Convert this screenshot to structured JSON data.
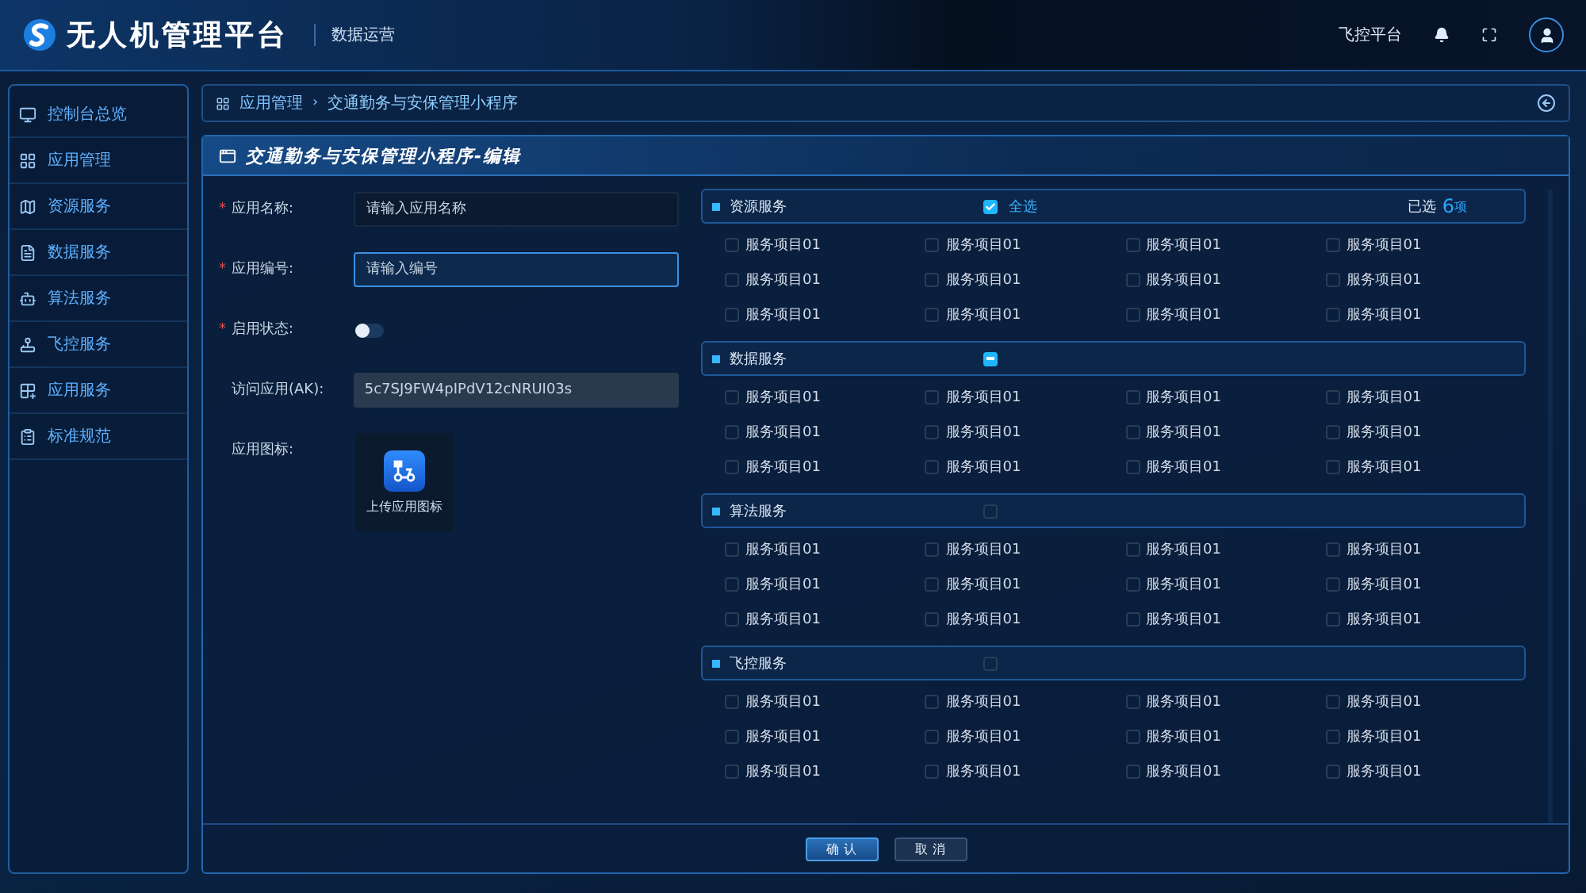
{
  "header": {
    "title": "无人机管理平台",
    "subtitle": "数据运营",
    "platform_link": "飞控平台"
  },
  "sidebar": {
    "items": [
      {
        "label": "控制台总览",
        "selected": false
      },
      {
        "label": "应用管理",
        "selected": false
      },
      {
        "label": "资源服务",
        "selected": false
      },
      {
        "label": "数据服务",
        "selected": false
      },
      {
        "label": "算法服务",
        "selected": false
      },
      {
        "label": "飞控服务",
        "selected": false
      },
      {
        "label": "应用服务",
        "selected": false
      },
      {
        "label": "标准规范",
        "selected": false
      }
    ]
  },
  "breadcrumb": {
    "separator": "›",
    "items": [
      "应用管理",
      "交通勤务与安保管理小程序"
    ]
  },
  "panel": {
    "title": "交通勤务与安保管理小程序-编辑",
    "form": [
      {
        "kind": "input",
        "label": "应用名称:",
        "required_mark": "*",
        "placeholder": "请输入应用名称",
        "focused": false
      },
      {
        "kind": "input",
        "label": "应用编号:",
        "required_mark": "*",
        "placeholder": "请输入编号",
        "focused": true
      },
      {
        "kind": "switch",
        "label": "启用状态:",
        "required_mark": "*",
        "on": false
      },
      {
        "kind": "readonly",
        "label": "访问应用(AK):",
        "value": "5c7SJ9FW4pIPdV12cNRUI03s"
      },
      {
        "kind": "upload",
        "label": "应用图标:",
        "caption": "上传应用图标"
      }
    ],
    "groups": [
      {
        "name": "资源服务",
        "checked": true,
        "indeterminate": false,
        "select_all": "全选",
        "selected_label": "已选",
        "selected_count": "6",
        "selected_unit": "项",
        "items": [
          {
            "label": "服务项目01",
            "checked": false
          },
          {
            "label": "服务项目01",
            "checked": false
          },
          {
            "label": "服务项目01",
            "checked": false
          },
          {
            "label": "服务项目01",
            "checked": false
          },
          {
            "label": "服务项目01",
            "checked": false
          },
          {
            "label": "服务项目01",
            "checked": false
          },
          {
            "label": "服务项目01",
            "checked": false
          },
          {
            "label": "服务项目01",
            "checked": false
          },
          {
            "label": "服务项目01",
            "checked": false
          },
          {
            "label": "服务项目01",
            "checked": false
          },
          {
            "label": "服务项目01",
            "checked": false
          },
          {
            "label": "服务项目01",
            "checked": false
          }
        ]
      },
      {
        "name": "数据服务",
        "checked": false,
        "indeterminate": true,
        "items": [
          {
            "label": "服务项目01",
            "checked": false
          },
          {
            "label": "服务项目01",
            "checked": false
          },
          {
            "label": "服务项目01",
            "checked": false
          },
          {
            "label": "服务项目01",
            "checked": false
          },
          {
            "label": "服务项目01",
            "checked": false
          },
          {
            "label": "服务项目01",
            "checked": false
          },
          {
            "label": "服务项目01",
            "checked": false
          },
          {
            "label": "服务项目01",
            "checked": false
          },
          {
            "label": "服务项目01",
            "checked": false
          },
          {
            "label": "服务项目01",
            "checked": false
          },
          {
            "label": "服务项目01",
            "checked": false
          },
          {
            "label": "服务项目01",
            "checked": false
          }
        ]
      },
      {
        "name": "算法服务",
        "checked": false,
        "indeterminate": false,
        "items": [
          {
            "label": "服务项目01",
            "checked": false
          },
          {
            "label": "服务项目01",
            "checked": false
          },
          {
            "label": "服务项目01",
            "checked": false
          },
          {
            "label": "服务项目01",
            "checked": false
          },
          {
            "label": "服务项目01",
            "checked": false
          },
          {
            "label": "服务项目01",
            "checked": false
          },
          {
            "label": "服务项目01",
            "checked": false
          },
          {
            "label": "服务项目01",
            "checked": false
          },
          {
            "label": "服务项目01",
            "checked": false
          },
          {
            "label": "服务项目01",
            "checked": false
          },
          {
            "label": "服务项目01",
            "checked": false
          },
          {
            "label": "服务项目01",
            "checked": false
          }
        ]
      },
      {
        "name": "飞控服务",
        "checked": false,
        "indeterminate": false,
        "items": [
          {
            "label": "服务项目01",
            "checked": false
          },
          {
            "label": "服务项目01",
            "checked": false
          },
          {
            "label": "服务项目01",
            "checked": false
          },
          {
            "label": "服务项目01",
            "checked": false
          },
          {
            "label": "服务项目01",
            "checked": false
          },
          {
            "label": "服务项目01",
            "checked": false
          },
          {
            "label": "服务项目01",
            "checked": false
          },
          {
            "label": "服务项目01",
            "checked": false
          },
          {
            "label": "服务项目01",
            "checked": false
          },
          {
            "label": "服务项目01",
            "checked": false
          },
          {
            "label": "服务项目01",
            "checked": false
          },
          {
            "label": "服务项目01",
            "checked": false
          }
        ]
      }
    ],
    "buttons": [
      {
        "label": "确 认",
        "primary": true
      },
      {
        "label": "取 消",
        "primary": false
      }
    ]
  }
}
